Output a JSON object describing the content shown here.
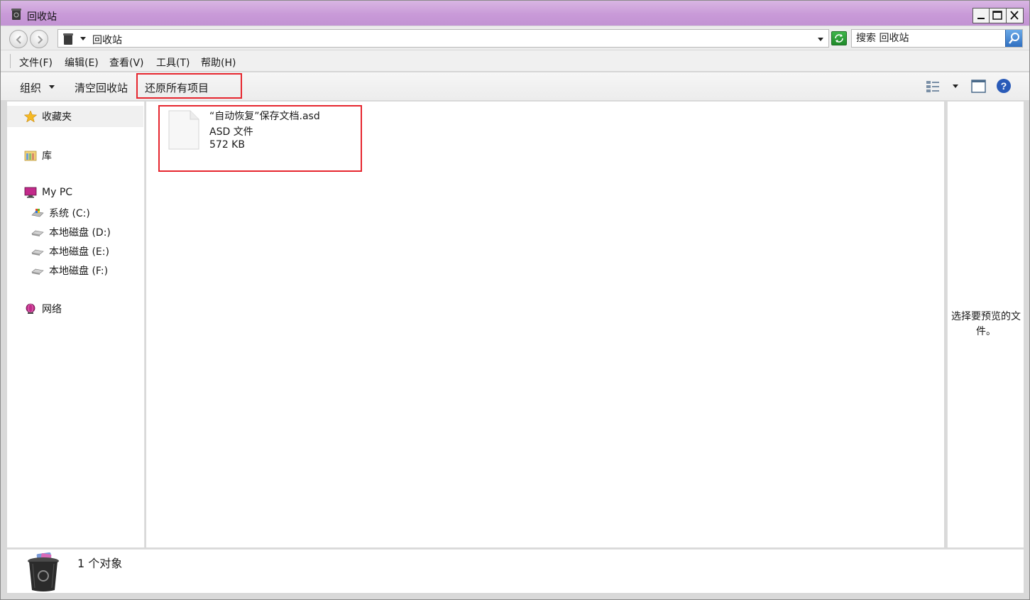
{
  "window": {
    "title": "回收站",
    "controls": {
      "minimize": "minimize-icon",
      "maximize": "maximize-icon",
      "close": "close-icon"
    }
  },
  "address": {
    "path": "回收站",
    "search_placeholder": "搜索 回收站"
  },
  "menu": {
    "items": [
      {
        "label": "文件(F)"
      },
      {
        "label": "编辑(E)"
      },
      {
        "label": "查看(V)"
      },
      {
        "label": "工具(T)"
      },
      {
        "label": "帮助(H)"
      }
    ]
  },
  "toolbar": {
    "organize": "组织",
    "empty_bin": "清空回收站",
    "restore_all": "还原所有项目"
  },
  "nav": {
    "favorites": "收藏夹",
    "libraries": "库",
    "computer": "My PC",
    "drives": [
      {
        "label": "系统 (C:)"
      },
      {
        "label": "本地磁盘 (D:)"
      },
      {
        "label": "本地磁盘 (E:)"
      },
      {
        "label": "本地磁盘 (F:)"
      }
    ],
    "network": "网络"
  },
  "files": [
    {
      "name": "“自动恢复”保存文档.asd",
      "type": "ASD 文件",
      "size": "572 KB"
    }
  ],
  "preview": {
    "message": "选择要预览的文件。"
  },
  "status": {
    "count_text": "1 个对象"
  },
  "colors": {
    "titlebar": "#c99ad8",
    "highlight": "#e6262e"
  }
}
